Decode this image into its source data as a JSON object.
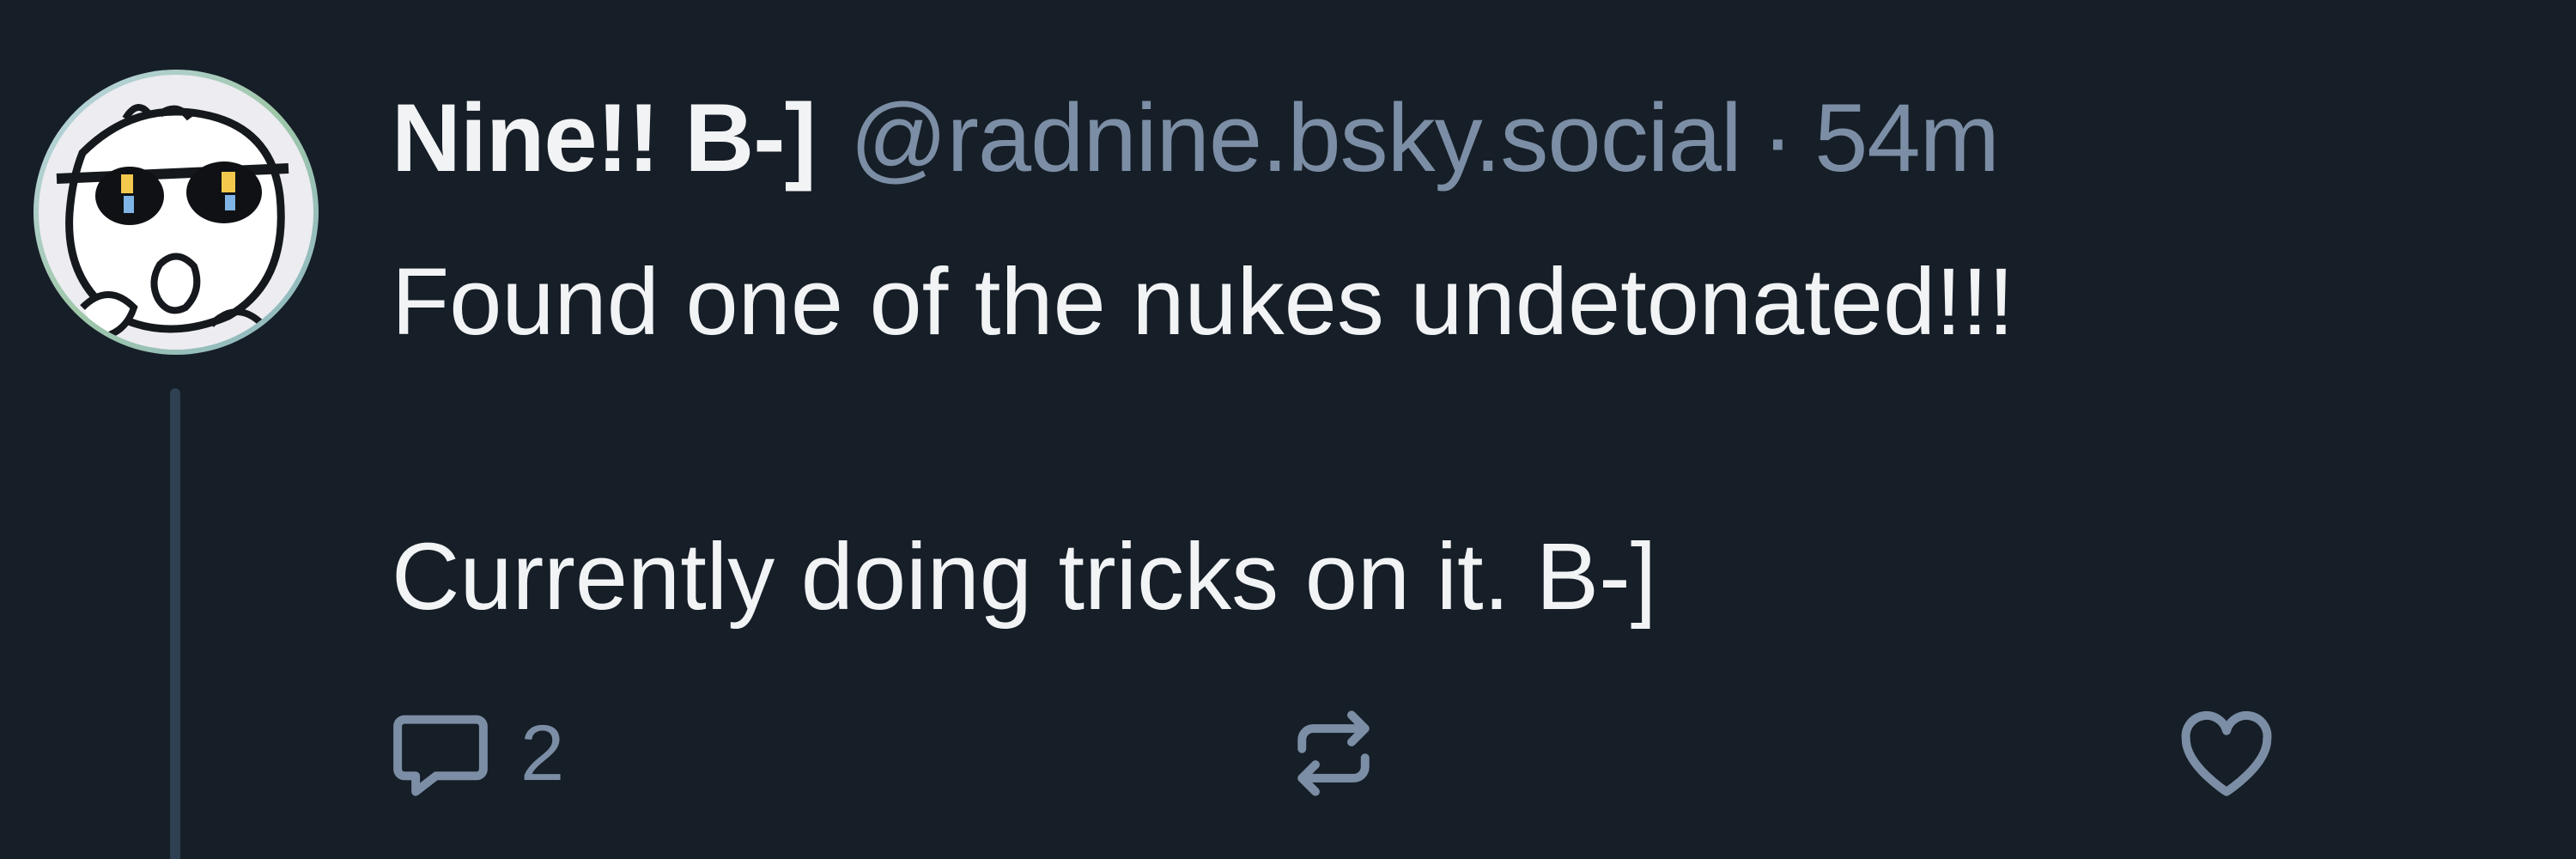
{
  "post": {
    "author": {
      "display_name": "Nine!! B-]",
      "handle": "@radnine.bsky.social",
      "avatar_icon": "cartoon-face-sunglasses-avatar"
    },
    "separator": "·",
    "timestamp": "54m",
    "text": "Found one of the nukes undetonated!!!\n\nCurrently doing tricks on it. B-]",
    "actions": {
      "reply": {
        "icon": "speech-bubble-icon",
        "count": "2"
      },
      "repost": {
        "icon": "repost-arrows-icon"
      },
      "like": {
        "icon": "heart-icon"
      }
    }
  },
  "colors": {
    "background": "#161e27",
    "primary_text": "#f1f3f5",
    "secondary_text": "#7b8ea5",
    "thread_line": "#2e4052"
  }
}
